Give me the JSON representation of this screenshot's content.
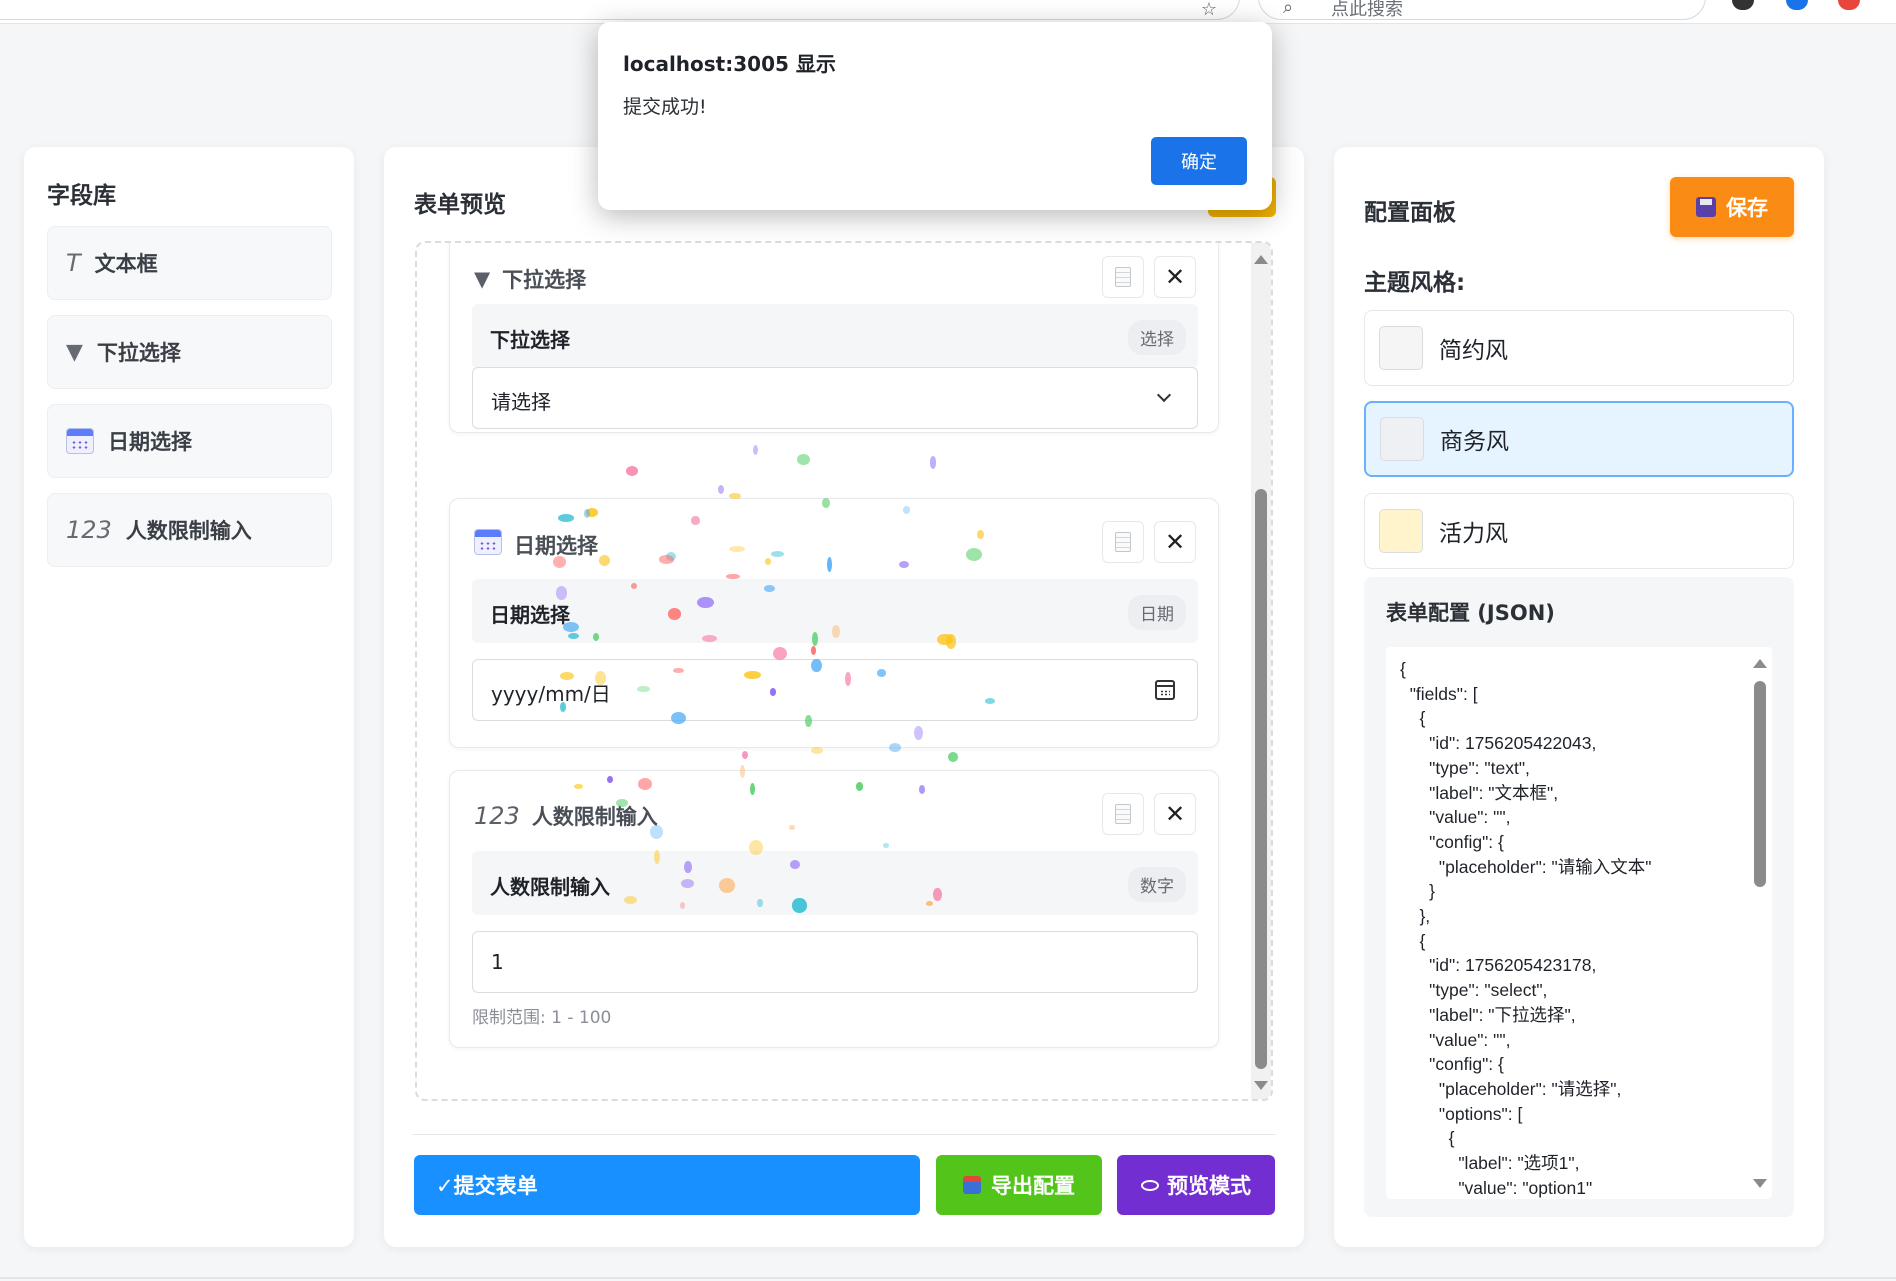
{
  "browser": {
    "search_hint": "点此搜索"
  },
  "dialog": {
    "title": "localhost:3005 显示",
    "message": "提交成功!",
    "ok_label": "确定"
  },
  "field_library": {
    "title": "字段库",
    "items": [
      {
        "icon_text": "T",
        "label": "文本框",
        "icon": "text-icon"
      },
      {
        "icon_text": "▼",
        "label": "下拉选择",
        "icon": "triangle-down-icon"
      },
      {
        "icon_text": "",
        "label": "日期选择",
        "icon": "calendar-icon"
      },
      {
        "icon_text": "123",
        "label": "人数限制输入",
        "icon": "number-icon"
      }
    ]
  },
  "form_preview": {
    "title": "表单预览",
    "cards": [
      {
        "head_icon": "▼",
        "head": "下拉选择",
        "label": "下拉选择",
        "tag": "选择",
        "value": "请选择"
      },
      {
        "head_icon": "",
        "head": "日期选择",
        "label": "日期选择",
        "tag": "日期",
        "value": "yyyy/mm/日"
      },
      {
        "head_icon": "123",
        "head": "人数限制输入",
        "label": "人数限制输入",
        "tag": "数字",
        "value": "1",
        "hint": "限制范围: 1 - 100"
      }
    ],
    "close_glyph": "✕",
    "actions": {
      "submit": "✓提交表单",
      "export": "导出配置",
      "preview": "预览模式"
    }
  },
  "config_panel": {
    "title": "配置面板",
    "save_label": "保存",
    "theme_label": "主题风格:",
    "themes": [
      {
        "name": "简约风",
        "swatch": "#f5f5f5",
        "active": false
      },
      {
        "name": "商务风",
        "swatch": "#eef0f3",
        "active": true
      },
      {
        "name": "活力风",
        "swatch": "#fff4cc",
        "active": false
      }
    ],
    "json_title": "表单配置 (JSON)",
    "json_text": "{\n  \"fields\": [\n    {\n      \"id\": 1756205422043,\n      \"type\": \"text\",\n      \"label\": \"文本框\",\n      \"value\": \"\",\n      \"config\": {\n        \"placeholder\": \"请输入文本\"\n      }\n    },\n    {\n      \"id\": 1756205423178,\n      \"type\": \"select\",\n      \"label\": \"下拉选择\",\n      \"value\": \"\",\n      \"config\": {\n        \"placeholder\": \"请选择\",\n        \"options\": [\n          {\n            \"label\": \"选项1\",\n            \"value\": \"option1\""
  },
  "colors": {
    "submit": "#1890ff",
    "export": "#52c41a",
    "preview": "#722ed1",
    "save": "#fa8c16",
    "dialog_ok": "#1a73e8"
  }
}
